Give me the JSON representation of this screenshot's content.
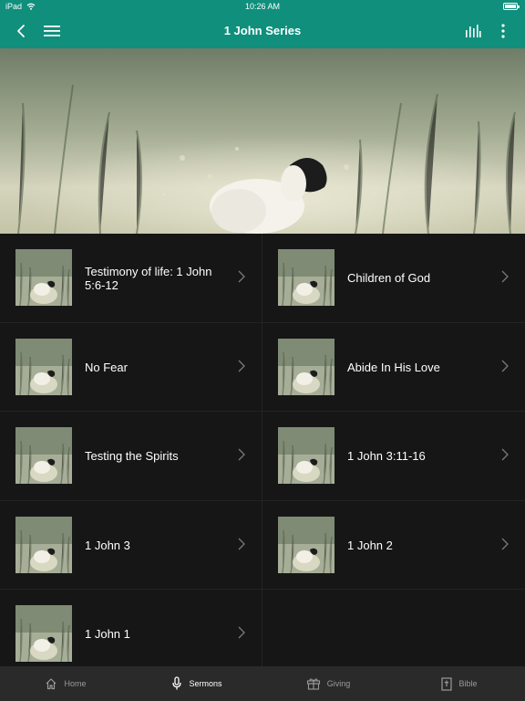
{
  "status_bar": {
    "device": "iPad",
    "time": "10:26 AM",
    "wifi_icon": "wifi-icon",
    "battery_icon": "battery-icon"
  },
  "header": {
    "title": "1 John Series",
    "back_icon": "back-chevron-icon",
    "menu_icon": "hamburger-menu-icon",
    "audio_icon": "audio-levels-icon",
    "more_icon": "more-vertical-icon",
    "background": "#0f8f7c"
  },
  "hero": {
    "image": "lamb-in-meadow-image"
  },
  "sermons": [
    {
      "title": "Testimony of life: 1 John 5:6-12"
    },
    {
      "title": "Children of God"
    },
    {
      "title": "No Fear"
    },
    {
      "title": "Abide In His Love"
    },
    {
      "title": "Testing the Spirits"
    },
    {
      "title": "1 John 3:11-16"
    },
    {
      "title": "1 John 3"
    },
    {
      "title": "1 John 2"
    },
    {
      "title": "1 John 1"
    }
  ],
  "tabs": [
    {
      "label": "Home",
      "icon": "home-icon",
      "active": false
    },
    {
      "label": "Sermons",
      "icon": "microphone-icon",
      "active": true
    },
    {
      "label": "Giving",
      "icon": "gift-icon",
      "active": false
    },
    {
      "label": "Bible",
      "icon": "bible-icon",
      "active": false
    }
  ]
}
